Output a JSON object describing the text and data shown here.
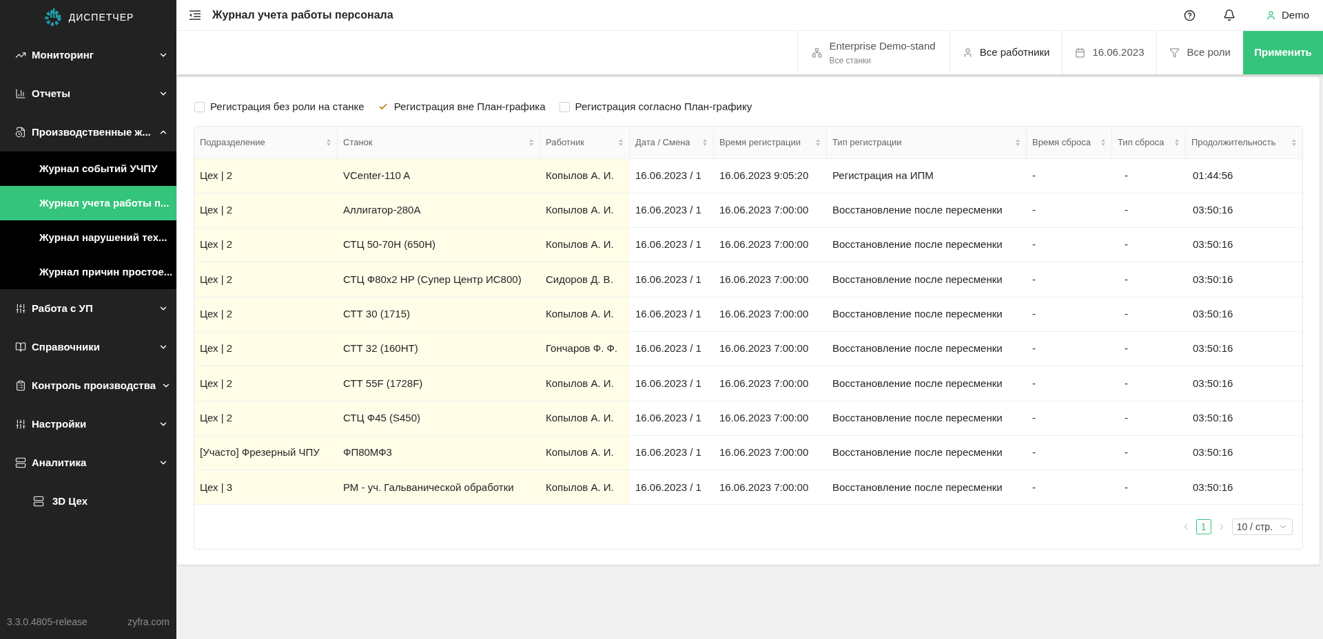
{
  "logo": {
    "text": "ДИСПЕТЧЕР"
  },
  "sidebar": {
    "items": [
      {
        "label": "Мониторинг",
        "kind": "group",
        "expanded": false
      },
      {
        "label": "Отчеты",
        "kind": "group",
        "expanded": false
      },
      {
        "label": "Производственные ж...",
        "kind": "group",
        "expanded": true,
        "children": [
          {
            "label": "Журнал событий УЧПУ",
            "selected": false
          },
          {
            "label": "Журнал учета работы п...",
            "selected": true
          },
          {
            "label": "Журнал нарушений тех...",
            "selected": false
          },
          {
            "label": "Журнал причин простое...",
            "selected": false
          }
        ]
      },
      {
        "label": "Работа с УП",
        "kind": "group",
        "expanded": false
      },
      {
        "label": "Справочники",
        "kind": "group",
        "expanded": false
      },
      {
        "label": "Контроль производства",
        "kind": "group",
        "expanded": false
      },
      {
        "label": "Настройки",
        "kind": "group",
        "expanded": false
      },
      {
        "label": "Аналитика",
        "kind": "group",
        "expanded": false
      },
      {
        "label": "3D Цех",
        "kind": "link"
      }
    ],
    "version": "3.3.0.4805-release",
    "site": "zyfra.com"
  },
  "header": {
    "title": "Журнал учета работы персонала",
    "user": "Demo"
  },
  "filters": {
    "enterprise": "Enterprise Demo-stand",
    "machines": "Все станки",
    "workers": "Все работники",
    "date": "16.06.2023",
    "roles": "Все роли",
    "apply": "Применить"
  },
  "checkboxes": [
    {
      "label": "Регистрация без роли на станке",
      "checked": false
    },
    {
      "label": "Регистрация вне План-графика",
      "checked": true
    },
    {
      "label": "Регистрация согласно План-графику",
      "checked": false
    }
  ],
  "table": {
    "columns": [
      {
        "label": "Подразделение",
        "pinned": true
      },
      {
        "label": "Станок",
        "pinned": true
      },
      {
        "label": "Работник",
        "pinned": true
      },
      {
        "label": "Дата / Смена",
        "pinned": false
      },
      {
        "label": "Время регистрации",
        "pinned": false
      },
      {
        "label": "Тип регистрации",
        "pinned": false
      },
      {
        "label": "Время сброса",
        "pinned": false
      },
      {
        "label": "Тип сброса",
        "pinned": false
      },
      {
        "label": "Продолжительность",
        "pinned": false
      }
    ],
    "rows": [
      [
        "Цех | 2",
        "VCenter-110 A",
        "Копылов А. И.",
        "16.06.2023 / 1",
        "16.06.2023 9:05:20",
        "Регистрация на ИПМ",
        "-",
        "-",
        "01:44:56"
      ],
      [
        "Цех | 2",
        "Аллигатор-280А",
        "Копылов А. И.",
        "16.06.2023 / 1",
        "16.06.2023 7:00:00",
        "Восстановление после пересменки",
        "-",
        "-",
        "03:50:16"
      ],
      [
        "Цех | 2",
        "СТЦ 50-70Н (650Н)",
        "Копылов А. И.",
        "16.06.2023 / 1",
        "16.06.2023 7:00:00",
        "Восстановление после пересменки",
        "-",
        "-",
        "03:50:16"
      ],
      [
        "Цех | 2",
        "СТЦ Ф80х2 HP (Супер Центр ИС800)",
        "Сидоров Д. В.",
        "16.06.2023 / 1",
        "16.06.2023 7:00:00",
        "Восстановление после пересменки",
        "-",
        "-",
        "03:50:16"
      ],
      [
        "Цех | 2",
        "СТТ 30 (1715)",
        "Копылов А. И.",
        "16.06.2023 / 1",
        "16.06.2023 7:00:00",
        "Восстановление после пересменки",
        "-",
        "-",
        "03:50:16"
      ],
      [
        "Цех | 2",
        "СТТ 32 (160НТ)",
        "Гончаров Ф. Ф.",
        "16.06.2023 / 1",
        "16.06.2023 7:00:00",
        "Восстановление после пересменки",
        "-",
        "-",
        "03:50:16"
      ],
      [
        "Цех | 2",
        "СТТ 55F (1728F)",
        "Копылов А. И.",
        "16.06.2023 / 1",
        "16.06.2023 7:00:00",
        "Восстановление после пересменки",
        "-",
        "-",
        "03:50:16"
      ],
      [
        "Цех | 2",
        "СТЦ Ф45 (S450)",
        "Копылов А. И.",
        "16.06.2023 / 1",
        "16.06.2023 7:00:00",
        "Восстановление после пересменки",
        "-",
        "-",
        "03:50:16"
      ],
      [
        "[Участо] Фрезерный ЧПУ",
        "ФП80МФ3",
        "Копылов А. И.",
        "16.06.2023 / 1",
        "16.06.2023 7:00:00",
        "Восстановление после пересменки",
        "-",
        "-",
        "03:50:16"
      ],
      [
        "Цех | 3",
        "РМ - уч. Гальванической обработки",
        "Копылов А. И.",
        "16.06.2023 / 1",
        "16.06.2023 7:00:00",
        "Восстановление после пересменки",
        "-",
        "-",
        "03:50:16"
      ]
    ]
  },
  "pagination": {
    "pages": [
      {
        "label": "1",
        "selected": true
      }
    ],
    "page_size": "10 / стр."
  }
}
